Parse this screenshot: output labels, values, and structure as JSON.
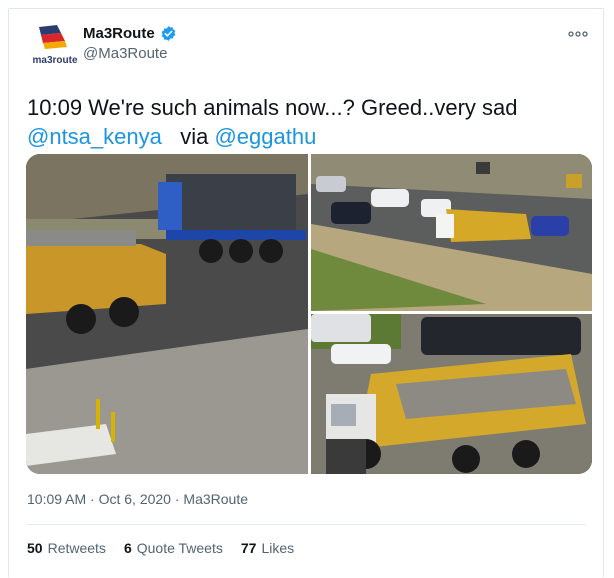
{
  "user": {
    "display_name": "Ma3Route",
    "handle": "@Ma3Route",
    "logo_text": "ma3route"
  },
  "tweet": {
    "text_prefix": "10:09 We're such animals now...? Greed..very sad",
    "mention1": "@ntsa_kenya",
    "via": "via",
    "mention2": "@eggathu",
    "timestamp": "10:09 AM · Oct 6, 2020 · Ma3Route"
  },
  "stats": {
    "retweets_count": "50",
    "retweets_label": "Retweets",
    "quotes_count": "6",
    "quotes_label": "Quote Tweets",
    "likes_count": "77",
    "likes_label": "Likes"
  },
  "colors": {
    "link": "#1b95e0",
    "verified": "#1d9bf0",
    "muted": "#536471"
  },
  "icons": [
    "ma3route-logo",
    "verified-badge-icon",
    "more-options-icon"
  ]
}
